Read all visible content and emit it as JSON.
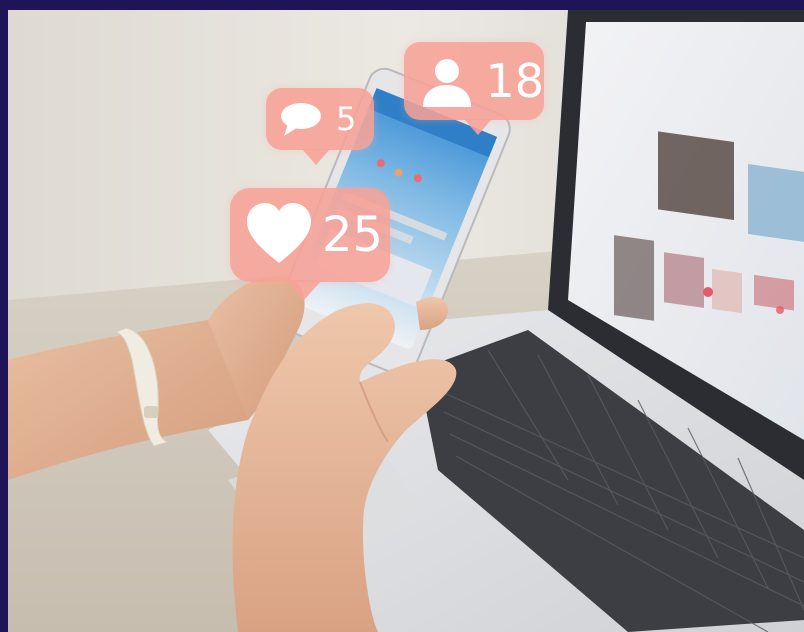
{
  "colors": {
    "border": "#1e1457",
    "bubble": "#f7a296",
    "bubble_text": "#ffffff"
  },
  "notifications": {
    "followers": {
      "icon": "person-icon",
      "count": "18"
    },
    "comments": {
      "icon": "speech-bubble-icon",
      "count": "5"
    },
    "likes": {
      "icon": "heart-icon",
      "count": "25"
    }
  }
}
